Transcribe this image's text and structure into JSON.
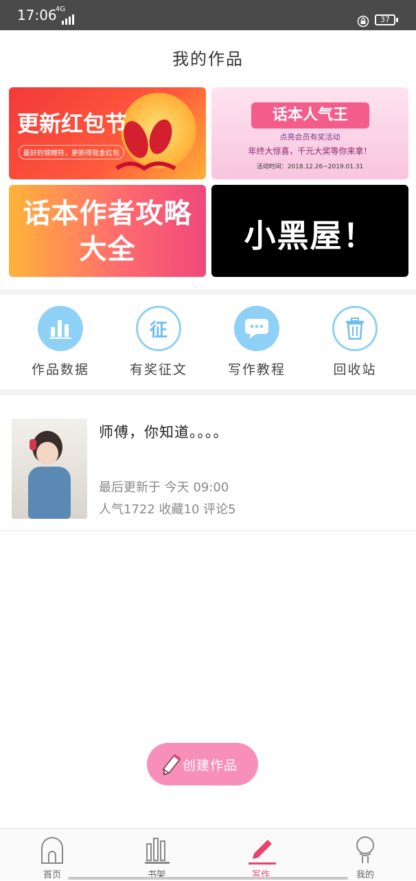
{
  "status_bar": {
    "time": "17:06",
    "network": "4G",
    "battery": "37"
  },
  "header": {
    "title": "我的作品"
  },
  "banners": [
    {
      "title": "更新红包节",
      "subtitle": "最好的锦鲤符，更新得现金红包"
    },
    {
      "title": "话本人气王",
      "subtitle": "点亮会员有奖活动",
      "line": "年终大惊喜，千元大奖等你来拿！",
      "date": "活动时间：2018.12.26~2019.01.31"
    },
    {
      "title_line1": "话本作者攻略",
      "title_line2": "大全"
    },
    {
      "title": "小黑屋！"
    }
  ],
  "quick_actions": [
    {
      "label": "作品数据",
      "icon": "bar-chart-icon"
    },
    {
      "label": "有奖征文",
      "icon": "zheng-badge-icon",
      "glyph": "征"
    },
    {
      "label": "写作教程",
      "icon": "chat-bubble-icon"
    },
    {
      "label": "回收站",
      "icon": "trash-icon"
    }
  ],
  "work": {
    "title": "师傅，你知道。。。。",
    "updated": "最后更新于 今天 09:00",
    "stats": "人气1722 收藏10 评论5"
  },
  "create_button": {
    "label": "创建作品"
  },
  "tabs": [
    {
      "label": "首页",
      "icon": "home-icon"
    },
    {
      "label": "书架",
      "icon": "bookshelf-icon"
    },
    {
      "label": "写作",
      "icon": "pen-icon",
      "active": true
    },
    {
      "label": "我的",
      "icon": "profile-icon"
    }
  ],
  "colors": {
    "accent": "#e6436f",
    "icon_blue": "#8fd0f7",
    "create_pink": "#f78fb8"
  }
}
